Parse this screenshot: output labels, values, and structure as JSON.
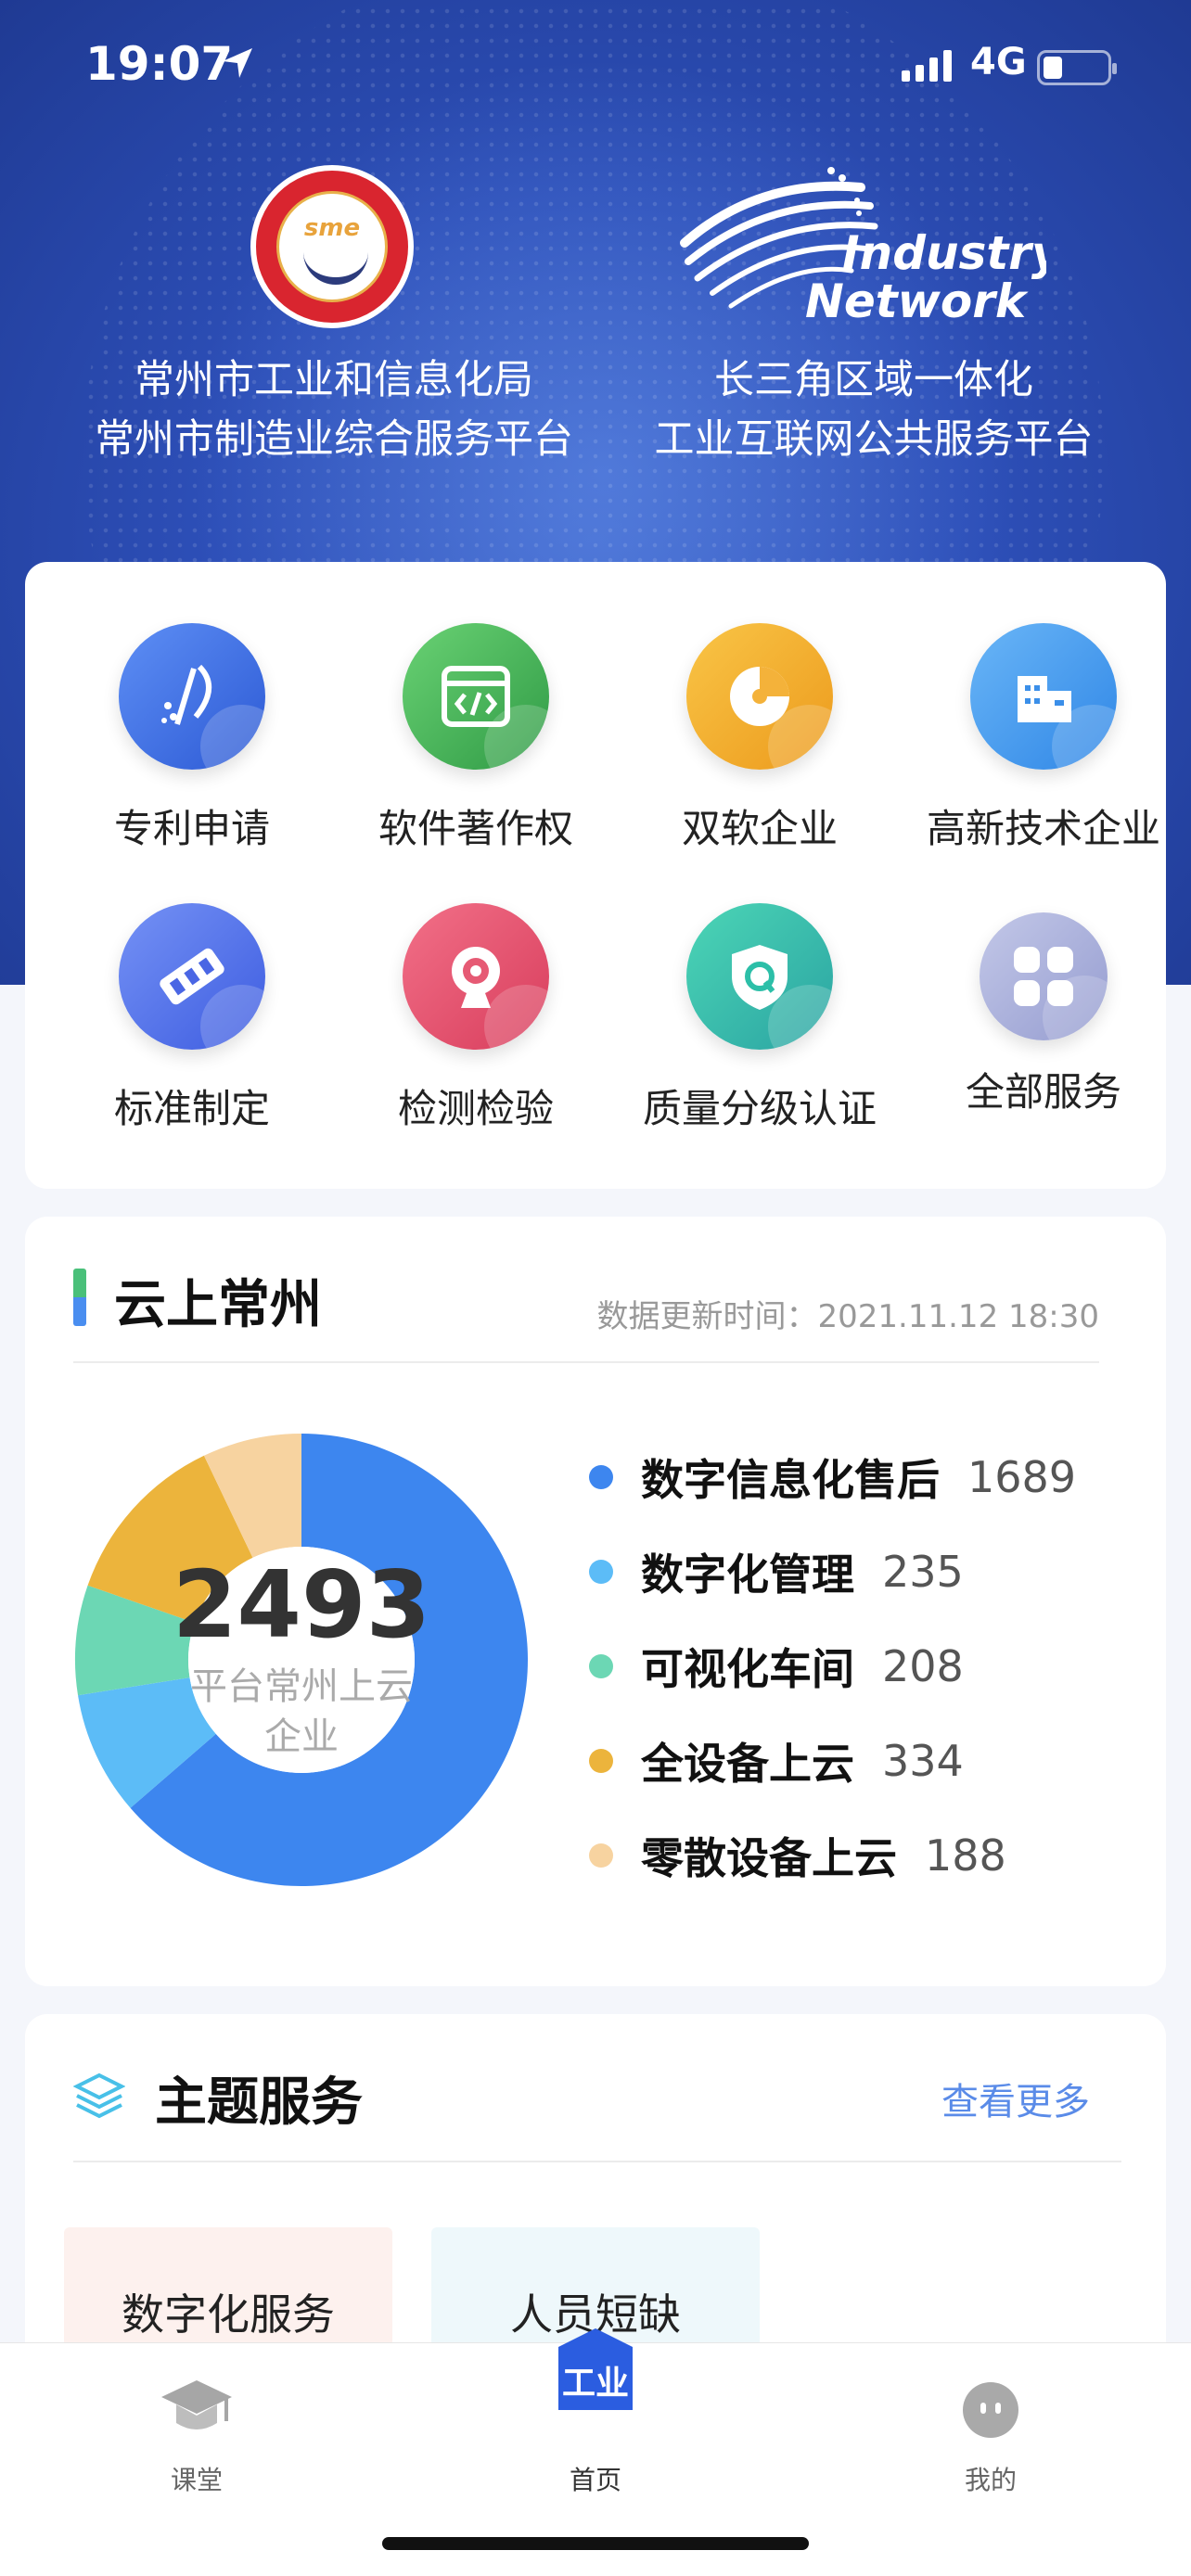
{
  "status_bar": {
    "time": "19:07",
    "network": "4G"
  },
  "header": {
    "left_caption_1": "常州市工业和信息化局",
    "left_caption_2": "常州市制造业综合服务平台",
    "right_caption_1": "长三角区域一体化",
    "right_caption_2": "工业互联网公共服务平台",
    "sme_logo_text": "sme",
    "industry_logo_text_1": "Industry",
    "industry_logo_text_2": "Network"
  },
  "services": [
    {
      "label": "专利申请",
      "icon": "patent-icon",
      "color": "#3a6fe0"
    },
    {
      "label": "软件著作权",
      "icon": "code-icon",
      "color": "#46b35a"
    },
    {
      "label": "双软企业",
      "icon": "pie-icon",
      "color": "#f2ac2c"
    },
    {
      "label": "高新技术企业",
      "icon": "building-icon",
      "color": "#4a9ef0"
    },
    {
      "label": "标准制定",
      "icon": "ruler-icon",
      "color": "#4a6ae6"
    },
    {
      "label": "检测检验",
      "icon": "camera-icon",
      "color": "#e65a74"
    },
    {
      "label": "质量分级认证",
      "icon": "shield-icon",
      "color": "#2cbfa8"
    },
    {
      "label": "全部服务",
      "icon": "grid-icon",
      "color": "#a8aedb"
    }
  ],
  "cloud": {
    "title": "云上常州",
    "update_label": "数据更新时间：2021.11.12 18:30",
    "center_value": "2493",
    "center_label": "平台常州上云企业"
  },
  "chart_data": {
    "type": "pie",
    "title": "云上常州",
    "categories": [
      "数字信息化售后",
      "数字化管理",
      "可视化车间",
      "全设备上云",
      "零散设备上云"
    ],
    "values": [
      1689,
      235,
      208,
      334,
      188
    ],
    "colors": [
      "#3d86ef",
      "#5cbcf7",
      "#6cd7b4",
      "#ecb43c",
      "#f7d3a0"
    ],
    "legend_position": "right"
  },
  "topic": {
    "title": "主题服务",
    "more": "查看更多",
    "cards": [
      {
        "label": "数字化服务",
        "bg": "#fdf1ee"
      },
      {
        "label": "人员短缺",
        "bg": "#eef8fb"
      }
    ]
  },
  "tabbar": {
    "items": [
      {
        "label": "课堂",
        "icon": "graduation-cap-icon"
      },
      {
        "label": "首页",
        "icon": "home-gongye-icon",
        "badge": "工业",
        "active": true
      },
      {
        "label": "我的",
        "icon": "profile-icon"
      }
    ]
  }
}
